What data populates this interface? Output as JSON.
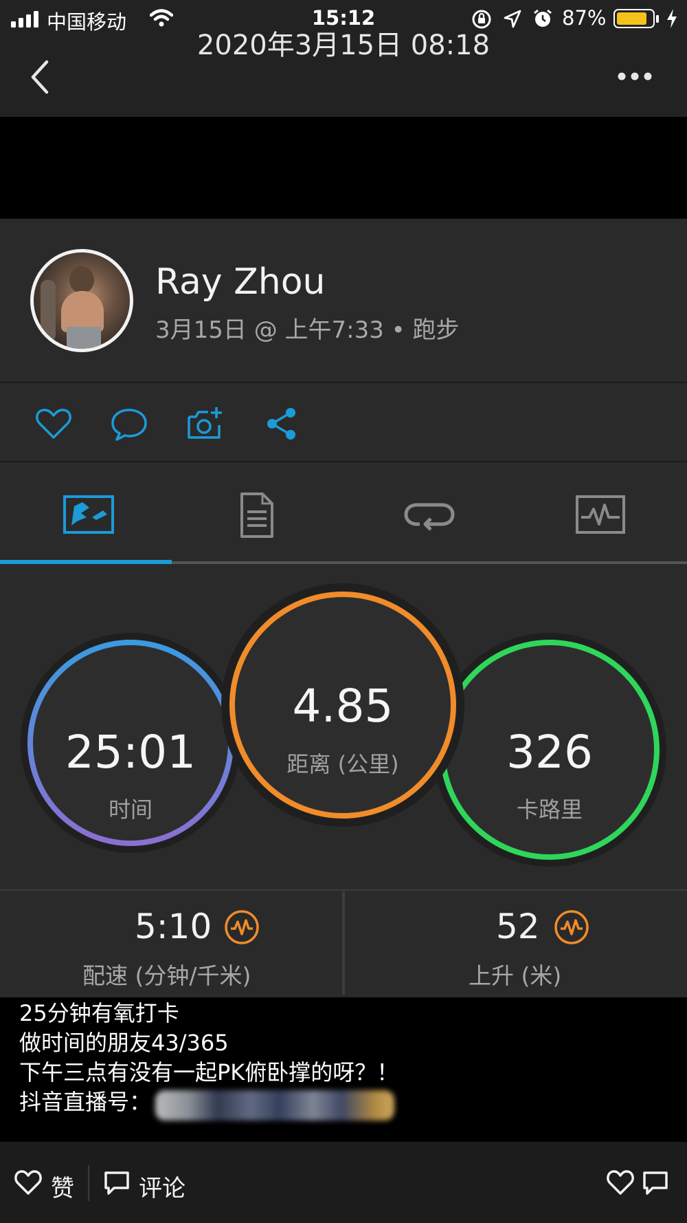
{
  "status_bar": {
    "carrier": "中国移动",
    "time": "15:12",
    "battery_percent": "87%",
    "battery_level": 0.87
  },
  "nav": {
    "title": "2020年3月15日 08:18"
  },
  "activity": {
    "user_name": "Ray Zhou",
    "meta": "3月15日 @ 上午7:33 • 跑步",
    "active_tab": "map",
    "stats": {
      "time": {
        "value": "25:01",
        "label": "时间"
      },
      "distance": {
        "value": "4.85",
        "label": "距离 (公里)"
      },
      "calories": {
        "value": "326",
        "label": "卡路里"
      }
    },
    "pace": {
      "value": "5:10",
      "label": "配速 (分钟/千米)"
    },
    "elevation": {
      "value": "52",
      "label": "上升 (米)"
    }
  },
  "caption": {
    "lines": [
      "25分钟有氧打卡",
      "做时间的朋友43/365",
      "下午三点有没有一起PK俯卧撑的呀？！",
      "抖音直播号："
    ]
  },
  "bottom_bar": {
    "like_label": "赞",
    "comment_label": "评论"
  },
  "colors": {
    "accent_blue": "#1b9bd7",
    "distance_orange": "#f08c2a",
    "calories_green": "#2fd65a",
    "time_blue": "#3a9be0",
    "time_purple": "#8c6fd0"
  }
}
